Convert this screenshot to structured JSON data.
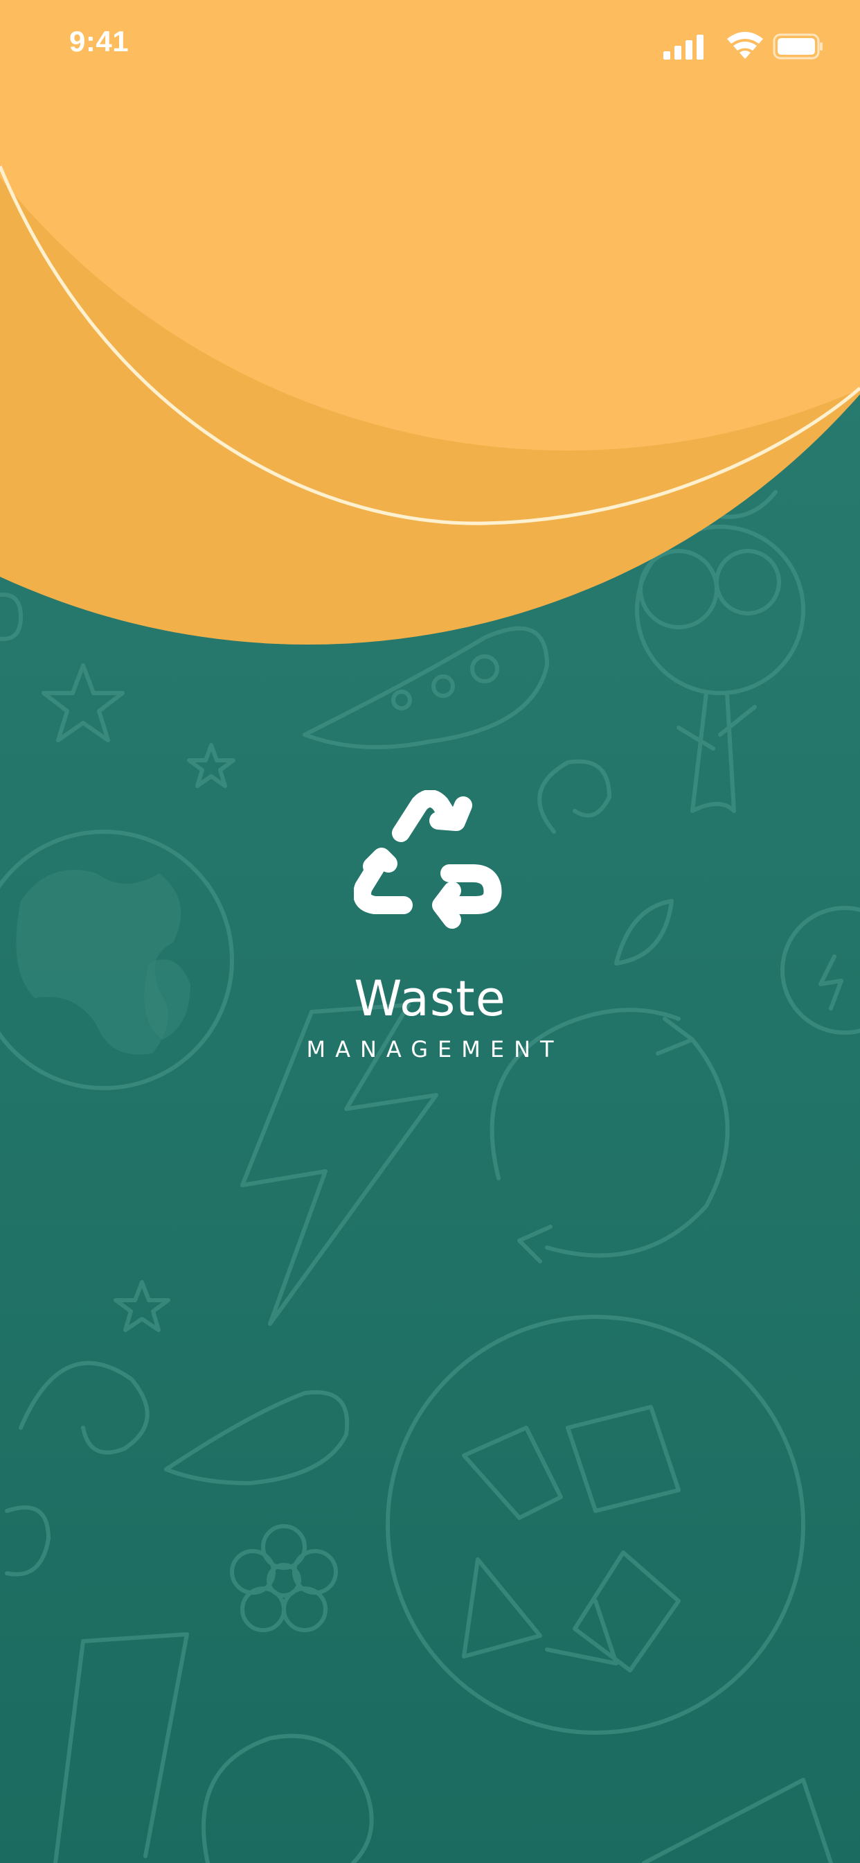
{
  "status_bar": {
    "time": "9:41",
    "icons": [
      "cellular-signal-icon",
      "wifi-icon",
      "battery-icon"
    ]
  },
  "brand": {
    "logo_icon": "recycle-icon",
    "title": "Waste",
    "subtitle": "MANAGEMENT"
  },
  "colors": {
    "background_top": "#2a7d72",
    "background_bottom": "#1c6b60",
    "blob_dark": "#f2b04a",
    "blob_light": "#fdbd5e",
    "ring": "#fff1cf",
    "text": "#ffffff"
  }
}
